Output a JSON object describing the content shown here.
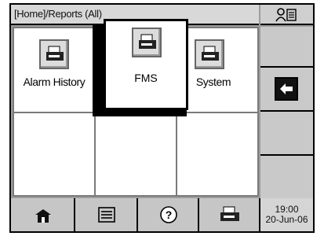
{
  "header": {
    "breadcrumb": "[Home]/Reports (All)",
    "user_icon": "user-list-icon"
  },
  "reports": [
    {
      "label": "Alarm History",
      "icon": "printer-icon"
    },
    {
      "label": "FMS",
      "icon": "printer-icon"
    },
    {
      "label": "System",
      "icon": "printer-icon"
    }
  ],
  "side": {
    "back_icon": "back-arrow-icon"
  },
  "bottom": {
    "buttons": [
      "home-icon",
      "list-icon",
      "help-icon",
      "printer-icon"
    ],
    "time": "19:00",
    "date": "20-Jun-06"
  }
}
